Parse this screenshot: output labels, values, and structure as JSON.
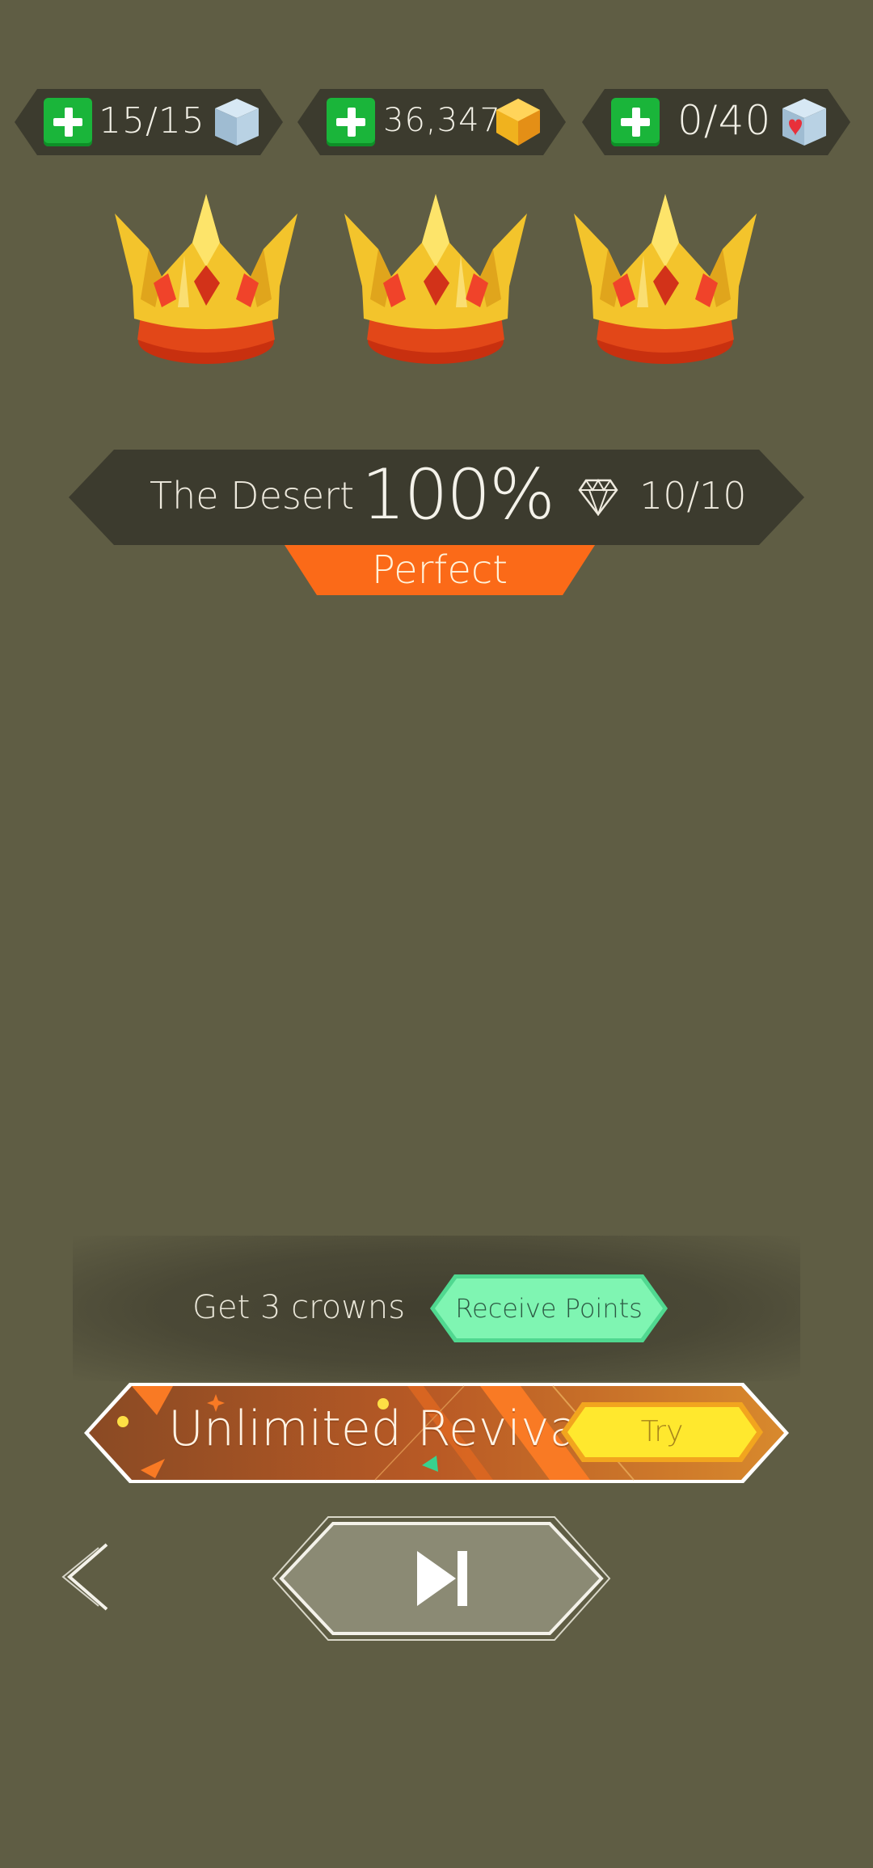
{
  "resources": {
    "energy": {
      "value": "15/15",
      "icon": "blue-cube-icon"
    },
    "coins": {
      "value": "36,347",
      "icon": "gold-cube-icon"
    },
    "hearts": {
      "value": "0/40",
      "icon": "heart-cube-icon"
    }
  },
  "crowns": {
    "earned": 3,
    "total": 3
  },
  "level": {
    "name": "The Desert",
    "percent": "100%",
    "gems": "10/10",
    "rating": "Perfect"
  },
  "task": {
    "text": "Get 3 crowns",
    "button_label": "Receive Points"
  },
  "promo": {
    "title": "Unlimited Revival",
    "button_label": "Try"
  },
  "navigation": {
    "back_icon": "chevron-left-icon",
    "next_icon": "skip-next-icon"
  },
  "colors": {
    "background": "#5f5d44",
    "banner": "#3c3b2e",
    "accent_orange": "#fb6a18",
    "plus_green": "#1ab53a",
    "receive_green": "#7ff5b2",
    "try_yellow": "#ffe82e"
  }
}
